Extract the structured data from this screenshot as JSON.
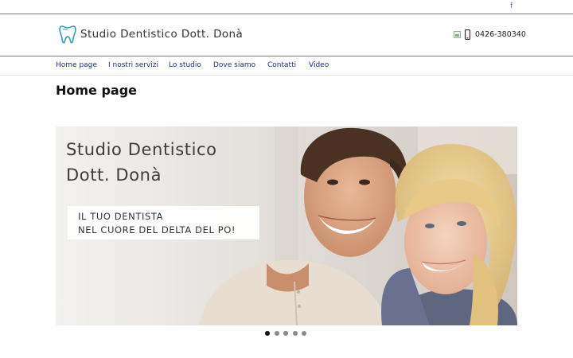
{
  "topbar": {
    "facebook_label": "f"
  },
  "header": {
    "site_title": "Studio Dentistico Dott. Donà",
    "phone": "0426-380340"
  },
  "nav": {
    "items": [
      {
        "label": "Home page"
      },
      {
        "label": "I nostri servizi"
      },
      {
        "label": "Lo studio"
      },
      {
        "label": "Dove siamo"
      },
      {
        "label": "Contatti"
      },
      {
        "label": "Video"
      }
    ]
  },
  "main": {
    "page_title": "Home page"
  },
  "slider": {
    "title_line1": "Studio Dentistico",
    "title_line2": "Dott. Donà",
    "tagline_line1": "IL TUO DENTISTA",
    "tagline_line2": "NEL CUORE DEL DELTA DEL PO!",
    "slide_count": 5,
    "active_slide": 1
  },
  "colors": {
    "nav_link": "#1d2aa8",
    "logo_tooth": "#2aa1b8",
    "facebook_link": "#4a6fc4"
  }
}
